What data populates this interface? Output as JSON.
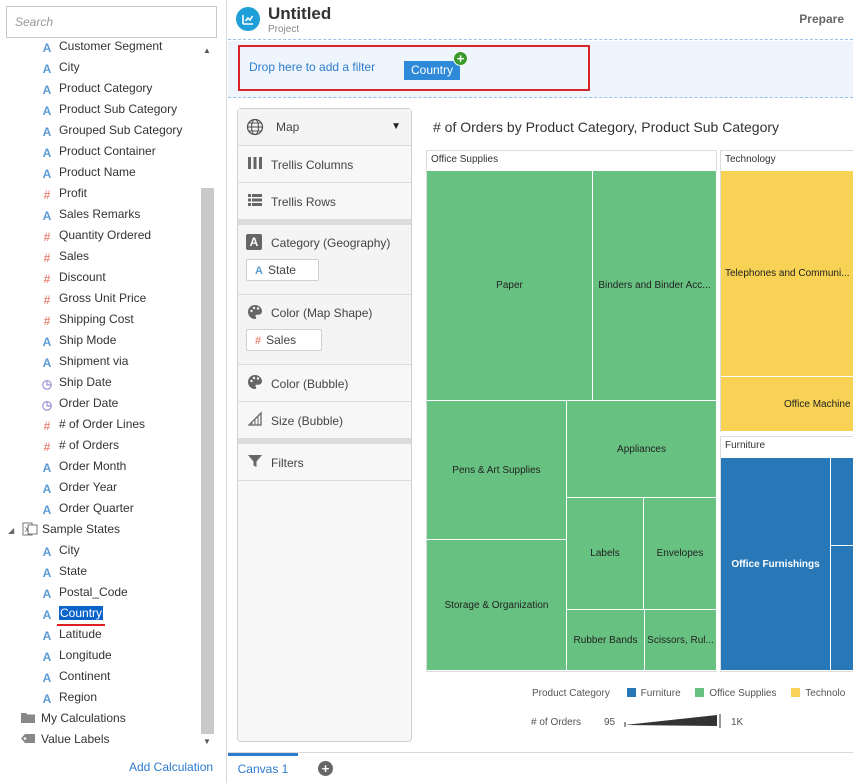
{
  "search": {
    "placeholder": "Search"
  },
  "tree": {
    "items": [
      {
        "label": "Customer Segment",
        "icon": "attribute-icon"
      },
      {
        "label": "City",
        "icon": "attribute-icon"
      },
      {
        "label": "Product Category",
        "icon": "attribute-icon"
      },
      {
        "label": "Product Sub Category",
        "icon": "attribute-icon"
      },
      {
        "label": "Grouped Sub Category",
        "icon": "attribute-icon"
      },
      {
        "label": "Product Container",
        "icon": "attribute-icon"
      },
      {
        "label": "Product Name",
        "icon": "attribute-icon"
      },
      {
        "label": "Profit",
        "icon": "measure-icon"
      },
      {
        "label": "Sales Remarks",
        "icon": "attribute-icon"
      },
      {
        "label": "Quantity Ordered",
        "icon": "measure-icon"
      },
      {
        "label": "Sales",
        "icon": "measure-icon"
      },
      {
        "label": "Discount",
        "icon": "measure-icon"
      },
      {
        "label": "Gross Unit Price",
        "icon": "measure-icon"
      },
      {
        "label": "Shipping Cost",
        "icon": "measure-icon"
      },
      {
        "label": "Ship Mode",
        "icon": "attribute-icon"
      },
      {
        "label": "Shipment via",
        "icon": "attribute-icon"
      },
      {
        "label": "Ship Date",
        "icon": "clock-icon"
      },
      {
        "label": "Order Date",
        "icon": "clock-icon"
      },
      {
        "label": "# of Order Lines",
        "icon": "measure-icon"
      },
      {
        "label": "# of Orders",
        "icon": "measure-icon"
      },
      {
        "label": "Order Month",
        "icon": "attribute-icon"
      },
      {
        "label": "Order Year",
        "icon": "attribute-icon"
      },
      {
        "label": "Order Quarter",
        "icon": "attribute-icon"
      }
    ],
    "sample_states": {
      "label": "Sample States",
      "items": [
        {
          "label": "City"
        },
        {
          "label": "State"
        },
        {
          "label": "Postal_Code"
        },
        {
          "label": "Country",
          "selected": true
        },
        {
          "label": "Latitude"
        },
        {
          "label": "Longitude"
        },
        {
          "label": "Continent"
        },
        {
          "label": "Region"
        }
      ]
    },
    "my_calculations": "My Calculations",
    "value_labels": "Value Labels"
  },
  "add_calculation": "Add Calculation",
  "header": {
    "title": "Untitled",
    "subtitle": "Project",
    "prepare": "Prepare"
  },
  "filter": {
    "hint": "Drop here to add a filter",
    "chip": "Country",
    "plus": "+"
  },
  "grammar": {
    "viz_type": "Map",
    "trellis_columns": "Trellis Columns",
    "trellis_rows": "Trellis Rows",
    "category": "Category (Geography)",
    "category_pill": "State",
    "color_map": "Color (Map Shape)",
    "color_map_pill": "Sales",
    "color_bubble": "Color (Bubble)",
    "size_bubble": "Size (Bubble)",
    "filters": "Filters"
  },
  "chart_data": {
    "type": "treemap",
    "title": "# of Orders by Product Category, Product Sub Category",
    "groups": [
      {
        "name": "Office Supplies",
        "tiles": [
          "Paper",
          "Binders and Binder Acc...",
          "Pens & Art Supplies",
          "Appliances",
          "Labels",
          "Envelopes",
          "Storage & Organization",
          "Rubber Bands",
          "Scissors, Rul..."
        ]
      },
      {
        "name": "Technology",
        "tiles": [
          "Telephones and Communi...",
          "Office Machine"
        ]
      },
      {
        "name": "Furniture",
        "tiles": [
          "Office Furnishings"
        ]
      }
    ],
    "legend": {
      "title": "Product Category",
      "items": [
        {
          "label": "Furniture",
          "color": "#2878b7"
        },
        {
          "label": "Office Supplies",
          "color": "#67c281"
        },
        {
          "label": "Technolo",
          "color": "#f7d254"
        }
      ]
    },
    "size_legend": {
      "title": "# of Orders",
      "min": "95",
      "max": "1K"
    }
  },
  "tabs": {
    "canvas1": "Canvas 1",
    "add": "+"
  }
}
